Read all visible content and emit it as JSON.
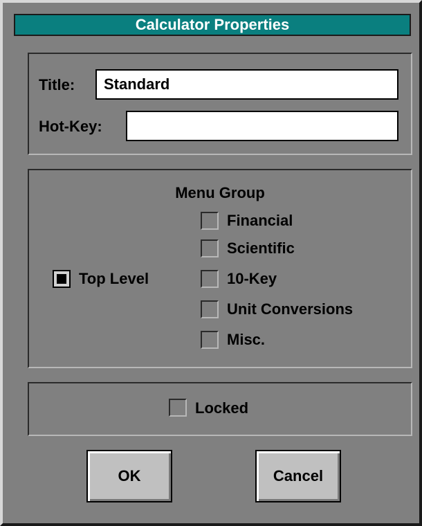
{
  "window": {
    "title": "Calculator Properties"
  },
  "fields": {
    "title_label": "Title:",
    "title_value": "Standard",
    "hotkey_label": "Hot-Key:",
    "hotkey_value": ""
  },
  "menu_group": {
    "heading": "Menu Group",
    "top_level": {
      "label": "Top Level",
      "checked": true
    },
    "options": [
      {
        "label": "Financial",
        "checked": false
      },
      {
        "label": "Scientific",
        "checked": false
      },
      {
        "label": "10-Key",
        "checked": false
      },
      {
        "label": "Unit Conversions",
        "checked": false
      },
      {
        "label": "Misc.",
        "checked": false
      }
    ]
  },
  "locked": {
    "label": "Locked",
    "checked": false
  },
  "buttons": {
    "ok": "OK",
    "cancel": "Cancel"
  },
  "colors": {
    "title_bar": "#0a7f7f",
    "dialog_bg": "#808080",
    "button_face": "#c0c0c0"
  }
}
